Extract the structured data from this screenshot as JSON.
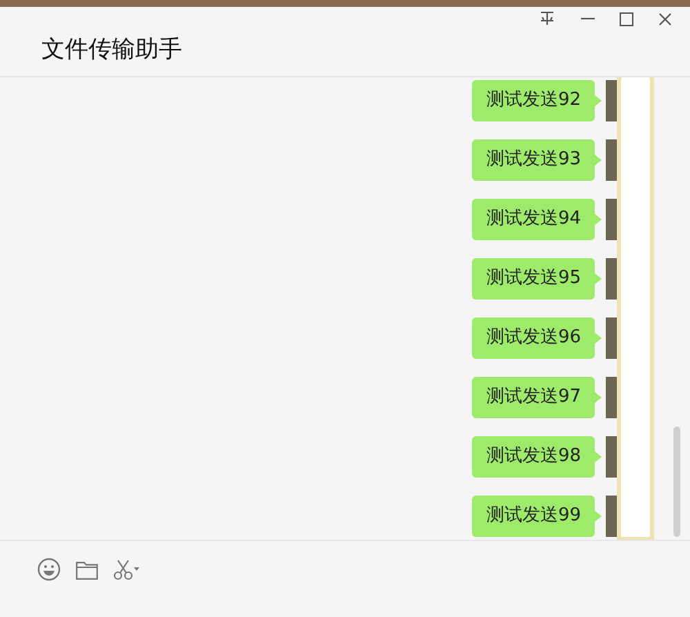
{
  "window": {
    "title": "文件传输助手"
  },
  "messages": [
    {
      "text": "测试发送92"
    },
    {
      "text": "测试发送93"
    },
    {
      "text": "测试发送94"
    },
    {
      "text": "测试发送95"
    },
    {
      "text": "测试发送96"
    },
    {
      "text": "测试发送97"
    },
    {
      "text": "测试发送98"
    },
    {
      "text": "测试发送99"
    }
  ]
}
